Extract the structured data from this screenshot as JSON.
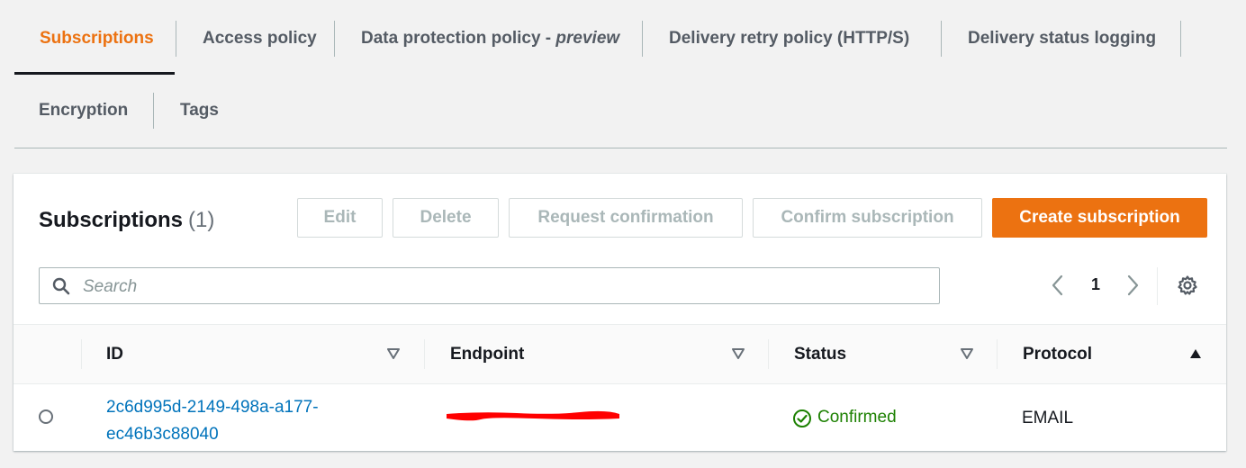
{
  "tabs": [
    {
      "label": "Subscriptions",
      "active": true
    },
    {
      "label": "Access policy"
    },
    {
      "label_main": "Data protection policy - ",
      "label_em": "preview"
    },
    {
      "label": "Delivery retry policy (HTTP/S)"
    },
    {
      "label": "Delivery status logging"
    },
    {
      "label": "Encryption"
    },
    {
      "label": "Tags"
    }
  ],
  "panel": {
    "title": "Subscriptions",
    "count": "(1)"
  },
  "actions": {
    "edit": "Edit",
    "delete": "Delete",
    "request_confirmation": "Request confirmation",
    "confirm_subscription": "Confirm subscription",
    "create_subscription": "Create subscription"
  },
  "search": {
    "placeholder": "Search",
    "value": ""
  },
  "pagination": {
    "current_page": "1",
    "icons": [
      "chevron-left-icon",
      "chevron-right-icon",
      "gear-icon"
    ]
  },
  "table": {
    "columns": [
      "ID",
      "Endpoint",
      "Status",
      "Protocol"
    ],
    "sort": {
      "column": "Protocol",
      "direction": "ascending"
    },
    "rows": [
      {
        "id_line1": "2c6d995d-2149-498a-a177-",
        "id_line2": "ec46b3c88040",
        "endpoint": "",
        "status": "Confirmed",
        "protocol": "EMAIL"
      }
    ]
  },
  "colors": {
    "accent": "#ec7211",
    "link": "#0073bb",
    "success": "#1d8102",
    "redaction": "#ff0000"
  }
}
